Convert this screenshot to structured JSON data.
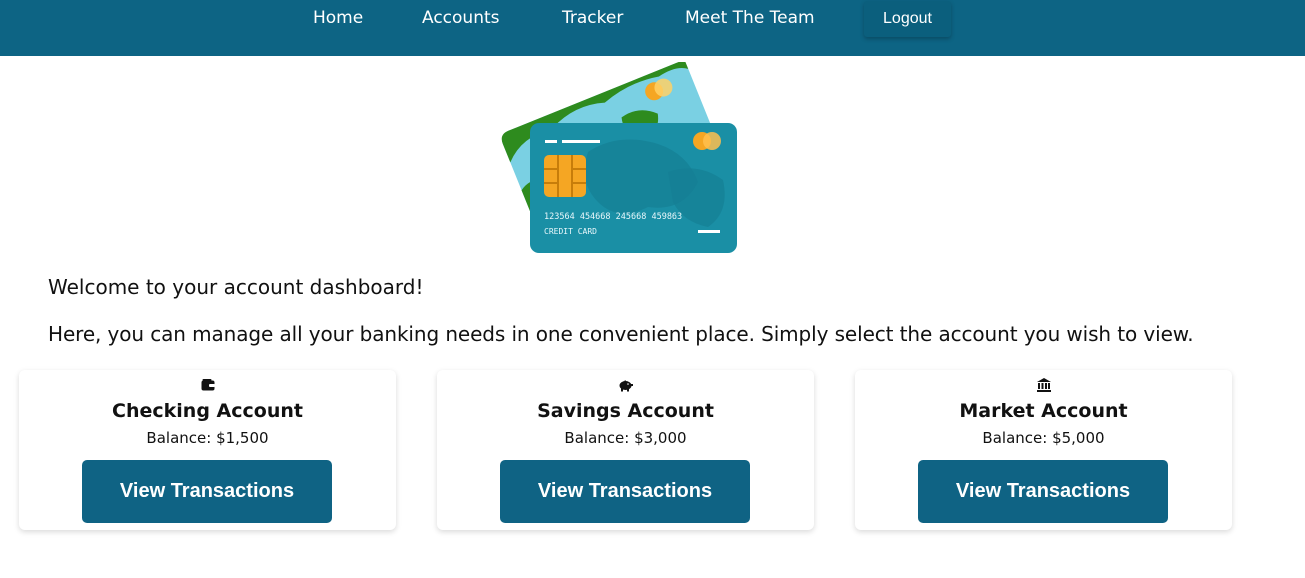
{
  "nav": {
    "home": "Home",
    "accounts": "Accounts",
    "tracker": "Tracker",
    "team": "Meet The Team",
    "logout": "Logout"
  },
  "hero": {
    "card_numbers": "123564  454668  245668  459863",
    "card_label": "CREDIT CARD"
  },
  "welcome": "Welcome to your account dashboard!",
  "intro": "Here, you can manage all your banking needs in one convenient place. Simply select the account you wish to view.",
  "accounts": [
    {
      "title": "Checking Account",
      "balance": "Balance: $1,500",
      "button": "View Transactions",
      "icon": "wallet-icon"
    },
    {
      "title": "Savings Account",
      "balance": "Balance: $3,000",
      "button": "View Transactions",
      "icon": "piggy-bank-icon"
    },
    {
      "title": "Market Account",
      "balance": "Balance: $5,000",
      "button": "View Transactions",
      "icon": "bank-icon"
    }
  ],
  "colors": {
    "primary": "#0d6484",
    "button": "#0f6384",
    "card_teal": "#1a8fa5",
    "card_back_blue": "#7ad0e3",
    "card_back_green": "#2e8b1e",
    "chip": "#f5a623"
  }
}
